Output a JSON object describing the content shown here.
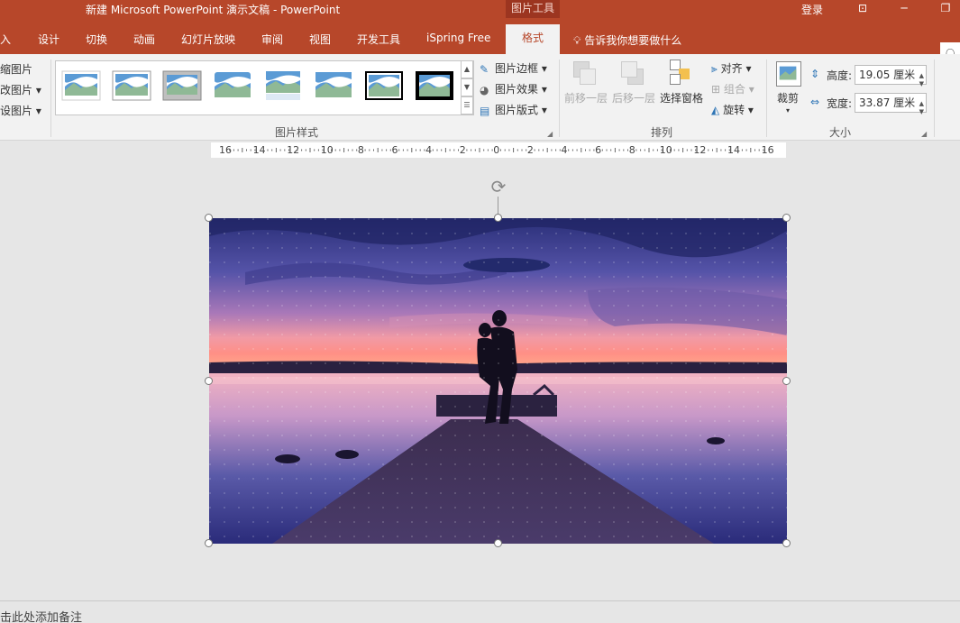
{
  "titlebar": {
    "title": "新建 Microsoft PowerPoint 演示文稿  -  PowerPoint",
    "context_tools": "图片工具",
    "login": "登录"
  },
  "tabs": [
    "入",
    "设计",
    "切换",
    "动画",
    "幻灯片放映",
    "审阅",
    "视图",
    "开发工具",
    "iSpring Free"
  ],
  "active_tab": "格式",
  "tell_me": "告诉我你想要做什么",
  "ribbon": {
    "left_items": [
      "缩图片",
      "改图片 ▾",
      "设图片 ▾"
    ],
    "picture_styles": {
      "label": "图片样式",
      "border": "图片边框",
      "effects": "图片效果",
      "layout": "图片版式"
    },
    "arrange": {
      "label": "排列",
      "bring_forward": "前移一层",
      "send_backward": "后移一层",
      "selection_pane": "选择窗格",
      "align": "对齐",
      "group": "组合",
      "rotate": "旋转"
    },
    "size": {
      "label": "大小",
      "crop": "裁剪",
      "height_label": "高度:",
      "height_value": "19.05 厘米",
      "width_label": "宽度:",
      "width_value": "33.87 厘米"
    }
  },
  "ruler": {
    "labels": [
      "16",
      "14",
      "12",
      "10",
      "8",
      "6",
      "4",
      "2",
      "0",
      "2",
      "4",
      "6",
      "8",
      "10",
      "12",
      "14",
      "16"
    ]
  },
  "notes": "击此处添加备注",
  "colors": {
    "accent": "#b7472a",
    "ribbon_bg": "#f2f2f2",
    "canvas_bg": "#e6e6e6"
  }
}
